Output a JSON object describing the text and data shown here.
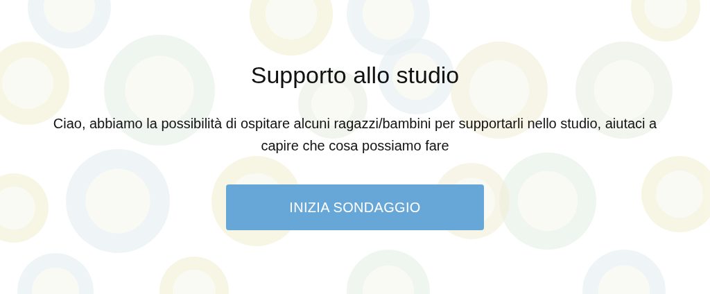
{
  "title": "Supporto allo studio",
  "description": "Ciao, abbiamo la possibilità di ospitare alcuni ragazzi/bambini per supportarli nello studio, aiutaci a capire che cosa possiamo fare",
  "button": {
    "label": "INIZIA SONDAGGIO"
  }
}
